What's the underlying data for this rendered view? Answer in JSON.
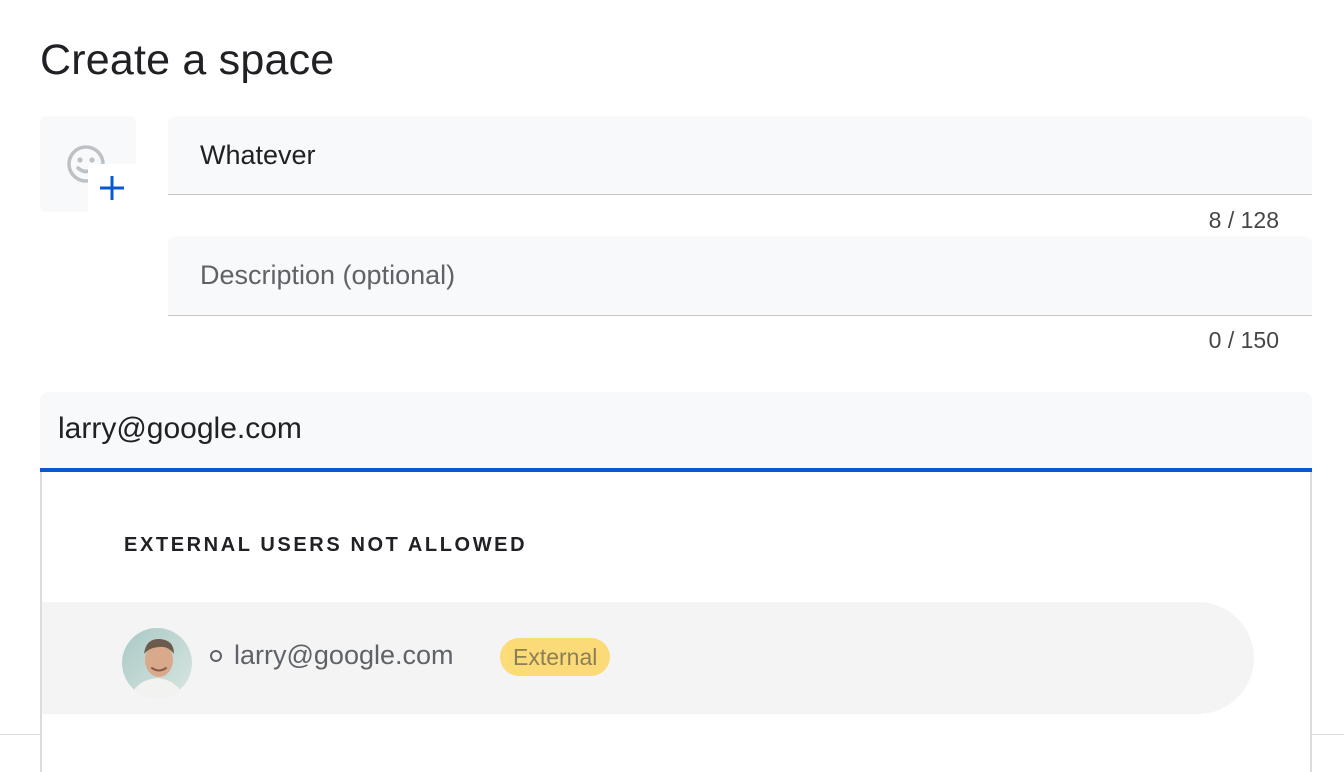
{
  "dialog": {
    "title": "Create a space"
  },
  "emoji_picker": {
    "icon": "add-reaction-icon"
  },
  "name_field": {
    "value": "Whatever",
    "counter": "8 / 128"
  },
  "description_field": {
    "value": "",
    "placeholder": "Description (optional)",
    "counter": "0 / 150"
  },
  "people_field": {
    "value": "larry@google.com"
  },
  "suggestions": {
    "heading": "EXTERNAL USERS NOT ALLOWED",
    "results": [
      {
        "email": "larry@google.com",
        "badge": "External",
        "status": "offline"
      }
    ]
  },
  "colors": {
    "accent": "#0b57d0",
    "field_bg": "#f8f9fa",
    "badge_bg": "#fdd663",
    "row_bg": "#f4f4f4"
  }
}
